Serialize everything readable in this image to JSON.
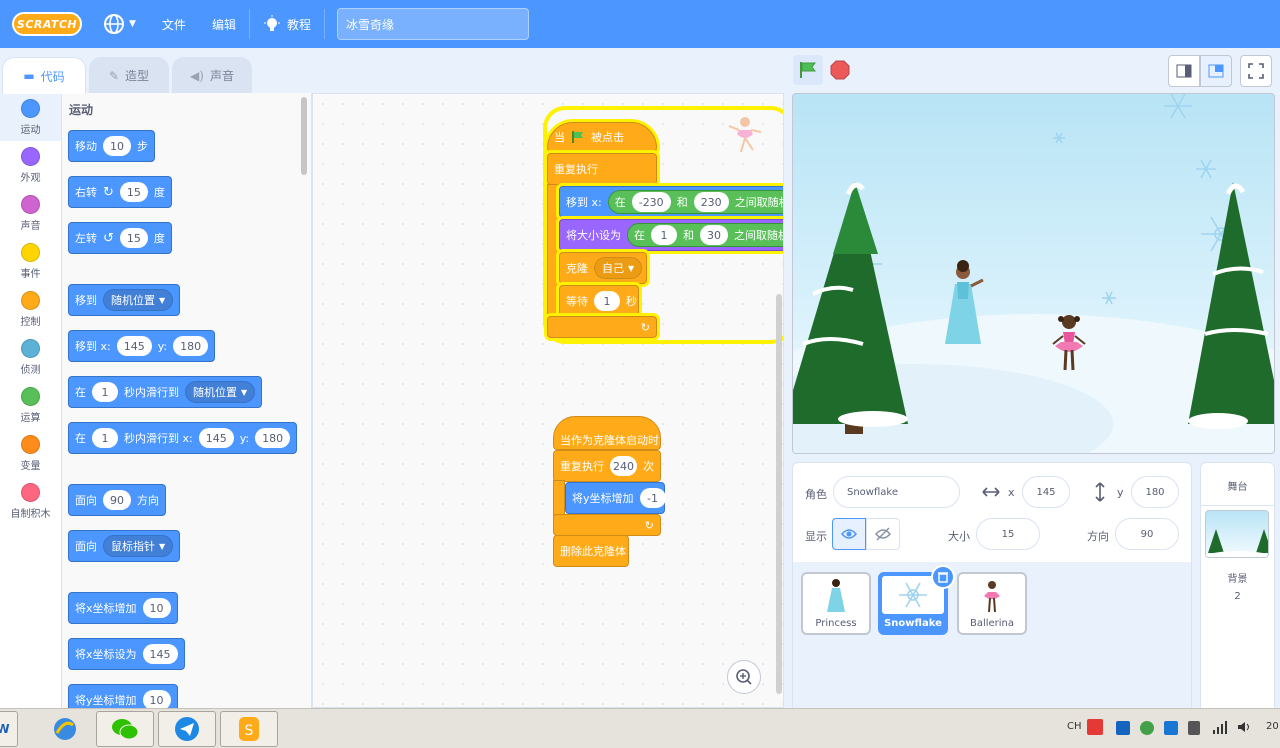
{
  "menubar": {
    "logo": "SCRATCH",
    "file": "文件",
    "edit": "编辑",
    "tutorials": "教程",
    "project_title": "冰雪奇缘"
  },
  "tabs": {
    "code": "代码",
    "costumes": "造型",
    "sounds": "声音"
  },
  "categories": [
    {
      "label": "运动",
      "color": "#4c97ff"
    },
    {
      "label": "外观",
      "color": "#9966ff"
    },
    {
      "label": "声音",
      "color": "#cf63cf"
    },
    {
      "label": "事件",
      "color": "#ffd500"
    },
    {
      "label": "控制",
      "color": "#ffab19"
    },
    {
      "label": "侦测",
      "color": "#5cb1d6"
    },
    {
      "label": "运算",
      "color": "#59c059"
    },
    {
      "label": "变量",
      "color": "#ff8c1a"
    },
    {
      "label": "自制积木",
      "color": "#ff6680"
    }
  ],
  "palette": {
    "heading": "运动",
    "move": {
      "a": "移动",
      "v": "10",
      "b": "步"
    },
    "turn_right": {
      "a": "右转",
      "v": "15",
      "b": "度"
    },
    "turn_left": {
      "a": "左转",
      "v": "15",
      "b": "度"
    },
    "goto": {
      "a": "移到",
      "dd": "随机位置"
    },
    "goto_xy": {
      "a": "移到 x:",
      "x": "145",
      "y_label": "y:",
      "y": "180"
    },
    "glide": {
      "a": "在",
      "v": "1",
      "b": "秒内滑行到",
      "dd": "随机位置"
    },
    "glide_xy": {
      "a": "在",
      "v": "1",
      "b": "秒内滑行到 x:",
      "x": "145",
      "y_label": "y:",
      "y": "180"
    },
    "point_dir": {
      "a": "面向",
      "v": "90",
      "b": "方向"
    },
    "point_towards": {
      "a": "面向",
      "dd": "鼠标指针"
    },
    "change_x": {
      "a": "将x坐标增加",
      "v": "10"
    },
    "set_x": {
      "a": "将x坐标设为",
      "v": "145"
    },
    "change_y": {
      "a": "将y坐标增加",
      "v": "10"
    }
  },
  "script1": {
    "hat_a": "当",
    "hat_b": "被点击",
    "forever": "重复执行",
    "goto_a": "移到 x:",
    "goto_in": "在",
    "goto_min": "-230",
    "goto_and": "和",
    "goto_max": "230",
    "goto_rand": "之间取随机数",
    "size_a": "将大小设为",
    "size_in": "在",
    "size_min": "1",
    "size_and": "和",
    "size_max": "30",
    "size_rand": "之间取随机数",
    "clone": "克隆",
    "clone_dd": "自己",
    "wait_a": "等待",
    "wait_v": "1",
    "wait_b": "秒"
  },
  "script2": {
    "hat": "当作为克隆体启动时",
    "repeat_a": "重复执行",
    "repeat_v": "240",
    "repeat_b": "次",
    "change_y": "将y坐标增加",
    "change_y_v": "-1",
    "delete": "删除此克隆体"
  },
  "sprite_info": {
    "sprite_label": "角色",
    "sprite_name": "Snowflake",
    "x_label": "x",
    "x": "145",
    "y_label": "y",
    "y": "180",
    "show_label": "显示",
    "size_label": "大小",
    "size": "15",
    "dir_label": "方向",
    "dir": "90"
  },
  "sprites": [
    {
      "name": "Princess"
    },
    {
      "name": "Snowflake"
    },
    {
      "name": "Ballerina"
    }
  ],
  "stage_panel": {
    "title": "舞台",
    "backdrops_label": "背景",
    "backdrops_count": "2"
  },
  "taskbar": {
    "ime": "CH",
    "clock": "20"
  },
  "colors": {
    "scratch_blue": "#4c97ff",
    "control_orange": "#ffab19",
    "operator_green": "#59c059",
    "looks_purple": "#9966ff"
  }
}
